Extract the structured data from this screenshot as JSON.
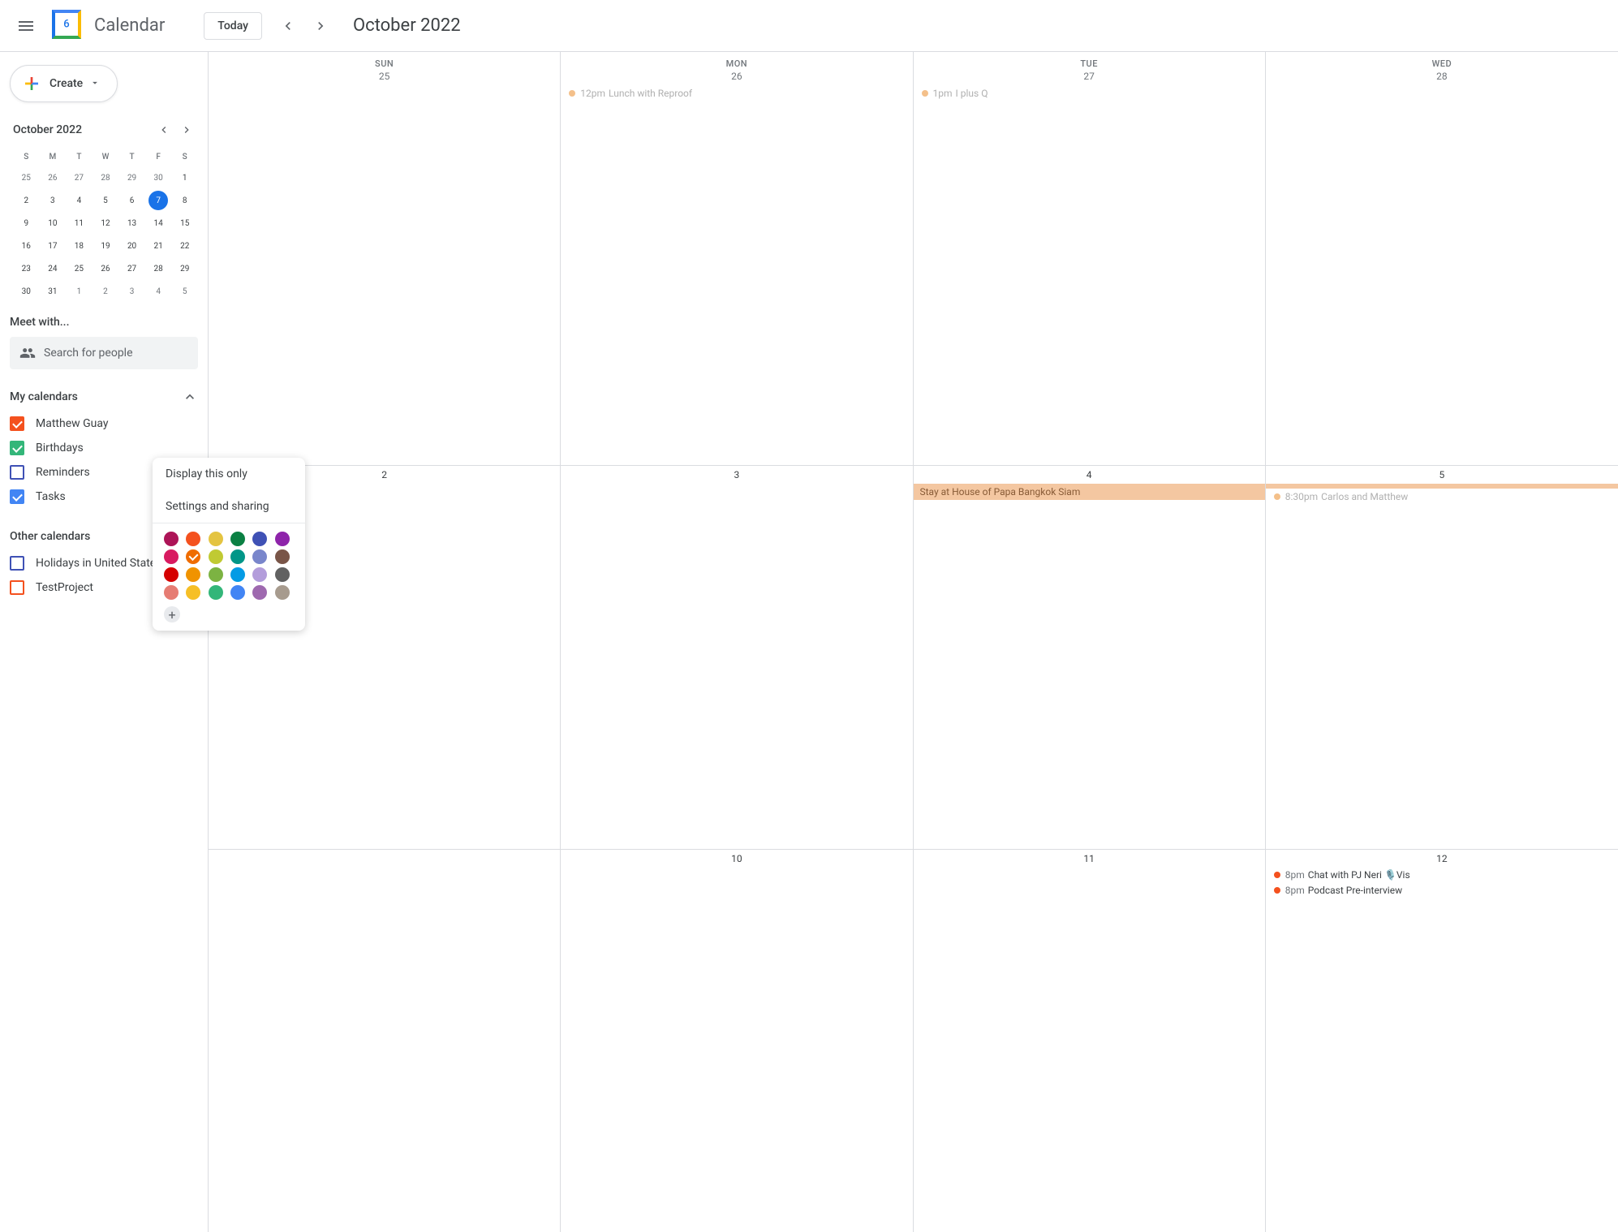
{
  "header": {
    "app_title": "Calendar",
    "logo_day": "6",
    "today_label": "Today",
    "current_month": "October 2022"
  },
  "sidebar": {
    "create_label": "Create",
    "mini": {
      "month": "October 2022",
      "dow": [
        "S",
        "M",
        "T",
        "W",
        "T",
        "F",
        "S"
      ],
      "weeks": [
        [
          {
            "n": "25"
          },
          {
            "n": "26"
          },
          {
            "n": "27"
          },
          {
            "n": "28"
          },
          {
            "n": "29"
          },
          {
            "n": "30"
          },
          {
            "n": "1",
            "cur": true
          }
        ],
        [
          {
            "n": "2",
            "cur": true
          },
          {
            "n": "3",
            "cur": true
          },
          {
            "n": "4",
            "cur": true
          },
          {
            "n": "5",
            "cur": true
          },
          {
            "n": "6",
            "cur": true
          },
          {
            "n": "7",
            "cur": true,
            "today": true
          },
          {
            "n": "8",
            "cur": true
          }
        ],
        [
          {
            "n": "9",
            "cur": true
          },
          {
            "n": "10",
            "cur": true
          },
          {
            "n": "11",
            "cur": true
          },
          {
            "n": "12",
            "cur": true
          },
          {
            "n": "13",
            "cur": true
          },
          {
            "n": "14",
            "cur": true
          },
          {
            "n": "15",
            "cur": true
          }
        ],
        [
          {
            "n": "16",
            "cur": true
          },
          {
            "n": "17",
            "cur": true
          },
          {
            "n": "18",
            "cur": true
          },
          {
            "n": "19",
            "cur": true
          },
          {
            "n": "20",
            "cur": true
          },
          {
            "n": "21",
            "cur": true
          },
          {
            "n": "22",
            "cur": true
          }
        ],
        [
          {
            "n": "23",
            "cur": true
          },
          {
            "n": "24",
            "cur": true
          },
          {
            "n": "25",
            "cur": true
          },
          {
            "n": "26",
            "cur": true
          },
          {
            "n": "27",
            "cur": true
          },
          {
            "n": "28",
            "cur": true
          },
          {
            "n": "29",
            "cur": true
          }
        ],
        [
          {
            "n": "30",
            "cur": true
          },
          {
            "n": "31",
            "cur": true
          },
          {
            "n": "1"
          },
          {
            "n": "2"
          },
          {
            "n": "3"
          },
          {
            "n": "4"
          },
          {
            "n": "5"
          }
        ]
      ]
    },
    "meet_title": "Meet with...",
    "search_placeholder": "Search for people",
    "my_calendars_title": "My calendars",
    "my_calendars": [
      {
        "label": "Matthew Guay",
        "color": "#f4511e",
        "checked": true
      },
      {
        "label": "Birthdays",
        "color": "#33b679",
        "checked": true
      },
      {
        "label": "Reminders",
        "color": "#3f51b5",
        "checked": false
      },
      {
        "label": "Tasks",
        "color": "#4285f4",
        "checked": true
      }
    ],
    "other_calendars_title": "Other calendars",
    "other_calendars": [
      {
        "label": "Holidays in United States",
        "color": "#3f51b5",
        "checked": false
      },
      {
        "label": "TestProject",
        "color": "#f4511e",
        "checked": false
      }
    ]
  },
  "popover": {
    "display_only": "Display this only",
    "settings_sharing": "Settings and sharing",
    "colors": [
      "#ad1457",
      "#f4511e",
      "#e4c441",
      "#0b8043",
      "#3f51b5",
      "#8e24aa",
      "#d81b60",
      "#ef6c00",
      "#c0ca33",
      "#009688",
      "#7986cb",
      "#795548",
      "#d50000",
      "#f09300",
      "#7cb342",
      "#039be5",
      "#b39ddb",
      "#616161",
      "#e67c73",
      "#f6bf26",
      "#33b679",
      "#4285f4",
      "#9e69af",
      "#a79b8e"
    ],
    "selected_color_index": 7
  },
  "grid": {
    "dow": [
      "SUN",
      "MON",
      "TUE",
      "WED"
    ],
    "header_days": [
      "25",
      "26",
      "27",
      "28"
    ],
    "rows": [
      [
        {
          "n": "25",
          "events": []
        },
        {
          "n": "26",
          "events": [
            {
              "time": "12pm",
              "title": "Lunch with Reproof",
              "dot": "#f4c08a",
              "dim": true
            }
          ]
        },
        {
          "n": "27",
          "events": [
            {
              "time": "1pm",
              "title": "I plus Q",
              "dot": "#f4c08a",
              "dim": true
            }
          ]
        },
        {
          "n": "28",
          "events": []
        }
      ],
      [
        {
          "n": "2",
          "events": []
        },
        {
          "n": "3",
          "events": []
        },
        {
          "n": "4",
          "bar": {
            "title": "Stay at House of Papa Bangkok Siam",
            "span": true
          },
          "events": []
        },
        {
          "n": "5",
          "bar": {
            "title": "",
            "span": false
          },
          "events": [
            {
              "time": "8:30pm",
              "title": "Carlos and Matthew",
              "dot": "#f4c08a",
              "dim": true
            }
          ]
        }
      ],
      [
        {
          "n": "",
          "events": []
        },
        {
          "n": "10",
          "events": []
        },
        {
          "n": "11",
          "events": []
        },
        {
          "n": "12",
          "events": [
            {
              "time": "8pm",
              "title": "Chat with PJ Neri 🎙️Vis",
              "dot": "#f4511e"
            },
            {
              "time": "8pm",
              "title": "Podcast Pre-interview",
              "dot": "#f4511e"
            }
          ]
        }
      ]
    ]
  }
}
